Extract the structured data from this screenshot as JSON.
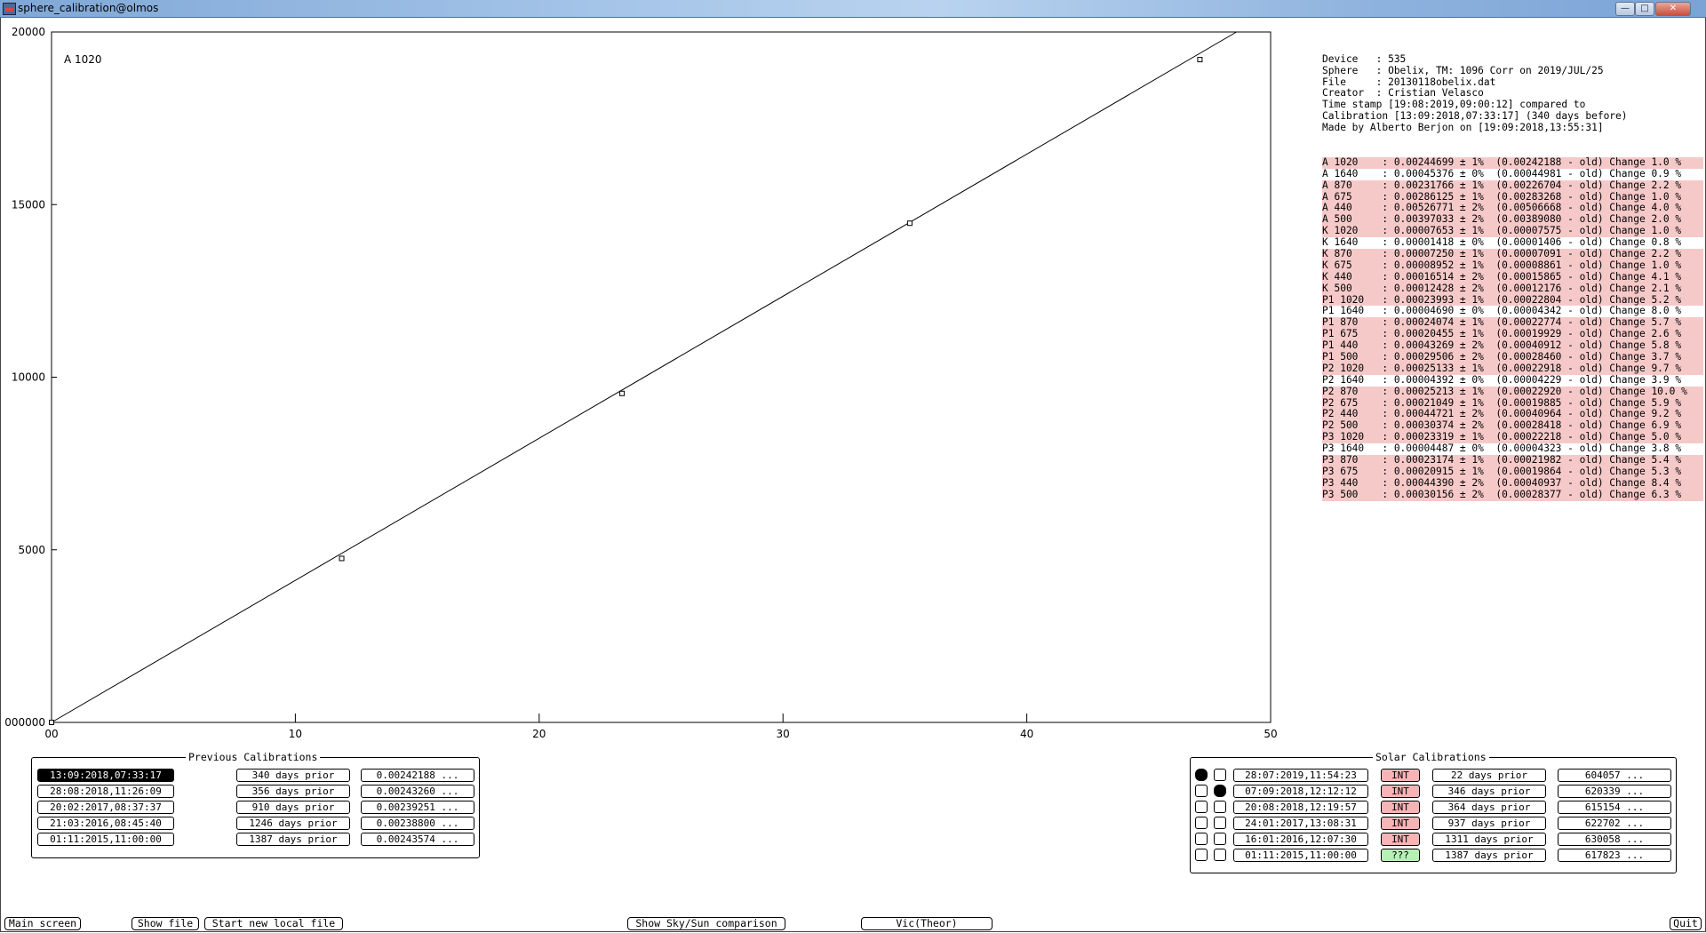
{
  "window": {
    "title": "sphere_calibration@olmos",
    "min_glyph": "—",
    "max_glyph": "□",
    "close_glyph": "✕"
  },
  "chart_data": {
    "type": "scatter",
    "annotation": "A 1020",
    "xlim": [
      0,
      50
    ],
    "ylim": [
      0,
      20000
    ],
    "x_ticks": [
      0,
      10,
      20,
      30,
      40,
      50
    ],
    "x_tick_labels": [
      "00",
      "10",
      "20",
      "30",
      "40",
      "50"
    ],
    "y_ticks": [
      0,
      5000,
      10000,
      15000,
      20000
    ],
    "y_tick_labels": [
      "000000",
      "5000",
      "10000",
      "15000",
      "20000"
    ],
    "points": [
      {
        "x": 0,
        "y": 0
      },
      {
        "x": 11.9,
        "y": 4750
      },
      {
        "x": 23.4,
        "y": 9530
      },
      {
        "x": 35.2,
        "y": 14460
      },
      {
        "x": 47.1,
        "y": 19200
      }
    ],
    "fit_line": {
      "x": [
        0,
        48.6
      ],
      "y": [
        0,
        20000
      ]
    },
    "grid": false,
    "xlabel": "",
    "ylabel": ""
  },
  "info": {
    "header": [
      "Device   : 535",
      "Sphere   : Obelix, TM: 1096 Corr on 2019/JUL/25",
      "File     : 20130118obelix.dat",
      "Creator  : Cristian Velasco",
      "Time stamp [19:08:2019,09:00:12] compared to",
      "Calibration [13:09:2018,07:33:17] (340 days before)",
      "Made by Alberto Berjon on [19:09:2018,13:55:31]"
    ],
    "cal_lines": [
      {
        "text": "A 1020    : 0.00244699 ± 1%  (0.00242188 - old) Change 1.0 %",
        "hi": true
      },
      {
        "text": "A 1640    : 0.00045376 ± 0%  (0.00044981 - old) Change 0.9 %",
        "hi": false
      },
      {
        "text": "A 870     : 0.00231766 ± 1%  (0.00226704 - old) Change 2.2 %",
        "hi": true
      },
      {
        "text": "A 675     : 0.00286125 ± 1%  (0.00283268 - old) Change 1.0 %",
        "hi": true
      },
      {
        "text": "A 440     : 0.00526771 ± 2%  (0.00506668 - old) Change 4.0 %",
        "hi": true
      },
      {
        "text": "A 500     : 0.00397033 ± 2%  (0.00389080 - old) Change 2.0 %",
        "hi": true
      },
      {
        "text": "K 1020    : 0.00007653 ± 1%  (0.00007575 - old) Change 1.0 %",
        "hi": true
      },
      {
        "text": "K 1640    : 0.00001418 ± 0%  (0.00001406 - old) Change 0.8 %",
        "hi": false
      },
      {
        "text": "K 870     : 0.00007250 ± 1%  (0.00007091 - old) Change 2.2 %",
        "hi": true
      },
      {
        "text": "K 675     : 0.00008952 ± 1%  (0.00008861 - old) Change 1.0 %",
        "hi": true
      },
      {
        "text": "K 440     : 0.00016514 ± 2%  (0.00015865 - old) Change 4.1 %",
        "hi": true
      },
      {
        "text": "K 500     : 0.00012428 ± 2%  (0.00012176 - old) Change 2.1 %",
        "hi": true
      },
      {
        "text": "P1 1020   : 0.00023993 ± 1%  (0.00022804 - old) Change 5.2 %",
        "hi": true
      },
      {
        "text": "P1 1640   : 0.00004690 ± 0%  (0.00004342 - old) Change 8.0 %",
        "hi": false
      },
      {
        "text": "P1 870    : 0.00024074 ± 1%  (0.00022774 - old) Change 5.7 %",
        "hi": true
      },
      {
        "text": "P1 675    : 0.00020455 ± 1%  (0.00019929 - old) Change 2.6 %",
        "hi": true
      },
      {
        "text": "P1 440    : 0.00043269 ± 2%  (0.00040912 - old) Change 5.8 %",
        "hi": true
      },
      {
        "text": "P1 500    : 0.00029506 ± 2%  (0.00028460 - old) Change 3.7 %",
        "hi": true
      },
      {
        "text": "P2 1020   : 0.00025133 ± 1%  (0.00022918 - old) Change 9.7 %",
        "hi": true
      },
      {
        "text": "P2 1640   : 0.00004392 ± 0%  (0.00004229 - old) Change 3.9 %",
        "hi": false
      },
      {
        "text": "P2 870    : 0.00025213 ± 1%  (0.00022920 - old) Change 10.0 %",
        "hi": true
      },
      {
        "text": "P2 675    : 0.00021049 ± 1%  (0.00019885 - old) Change 5.9 %",
        "hi": true
      },
      {
        "text": "P2 440    : 0.00044721 ± 2%  (0.00040964 - old) Change 9.2 %",
        "hi": true
      },
      {
        "text": "P2 500    : 0.00030374 ± 2%  (0.00028418 - old) Change 6.9 %",
        "hi": true
      },
      {
        "text": "P3 1020   : 0.00023319 ± 1%  (0.00022218 - old) Change 5.0 %",
        "hi": true
      },
      {
        "text": "P3 1640   : 0.00004487 ± 0%  (0.00004323 - old) Change 3.8 %",
        "hi": false
      },
      {
        "text": "P3 870    : 0.00023174 ± 1%  (0.00021982 - old) Change 5.4 %",
        "hi": true
      },
      {
        "text": "P3 675    : 0.00020915 ± 1%  (0.00019864 - old) Change 5.3 %",
        "hi": true
      },
      {
        "text": "P3 440    : 0.00044390 ± 2%  (0.00040937 - old) Change 8.4 %",
        "hi": true
      },
      {
        "text": "P3 500    : 0.00030156 ± 2%  (0.00028377 - old) Change 6.3 %",
        "hi": true
      }
    ],
    "highlight_color": "#f6c9c9"
  },
  "previous_calibrations": {
    "title": "Previous Calibrations",
    "rows": [
      {
        "date": "13:09:2018,07:33:17",
        "prior": "340 days prior",
        "value": "0.00242188 ...",
        "selected": true
      },
      {
        "date": "28:08:2018,11:26:09",
        "prior": "356 days prior",
        "value": "0.00243260 ...",
        "selected": false
      },
      {
        "date": "20:02:2017,08:37:37",
        "prior": "910 days prior",
        "value": "0.00239251 ...",
        "selected": false
      },
      {
        "date": "21:03:2016,08:45:40",
        "prior": "1246 days prior",
        "value": "0.00238800 ...",
        "selected": false
      },
      {
        "date": "01:11:2015,11:00:00",
        "prior": "1387 days prior",
        "value": "0.00243574 ...",
        "selected": false
      }
    ]
  },
  "solar_calibrations": {
    "title": "Solar Calibrations",
    "rows": [
      {
        "check1": true,
        "check2": false,
        "date": "28:07:2019,11:54:23",
        "badge": "INT",
        "badge_type": "int",
        "prior": "22 days prior",
        "value": "604057 ..."
      },
      {
        "check1": false,
        "check2": true,
        "date": "07:09:2018,12:12:12",
        "badge": "INT",
        "badge_type": "int",
        "prior": "346 days prior",
        "value": "620339 ..."
      },
      {
        "check1": false,
        "check2": false,
        "date": "20:08:2018,12:19:57",
        "badge": "INT",
        "badge_type": "int",
        "prior": "364 days prior",
        "value": "615154 ..."
      },
      {
        "check1": false,
        "check2": false,
        "date": "24:01:2017,13:08:31",
        "badge": "INT",
        "badge_type": "int",
        "prior": "937 days prior",
        "value": "622702 ..."
      },
      {
        "check1": false,
        "check2": false,
        "date": "16:01:2016,12:07:30",
        "badge": "INT",
        "badge_type": "int",
        "prior": "1311 days prior",
        "value": "630058 ..."
      },
      {
        "check1": false,
        "check2": false,
        "date": "01:11:2015,11:00:00",
        "badge": "???",
        "badge_type": "unk",
        "prior": "1387 days prior",
        "value": "617823 ..."
      }
    ],
    "int_color": "#f5b5b5",
    "unknown_color": "#b7f0b7"
  },
  "bottom_bar": {
    "main_screen": "Main screen",
    "show_file": "Show file",
    "start_new_local_file": "Start new local file",
    "show_sky_sun": "Show Sky/Sun comparison",
    "vic_theor": "Vic(Theor)",
    "quit": "Quit"
  }
}
